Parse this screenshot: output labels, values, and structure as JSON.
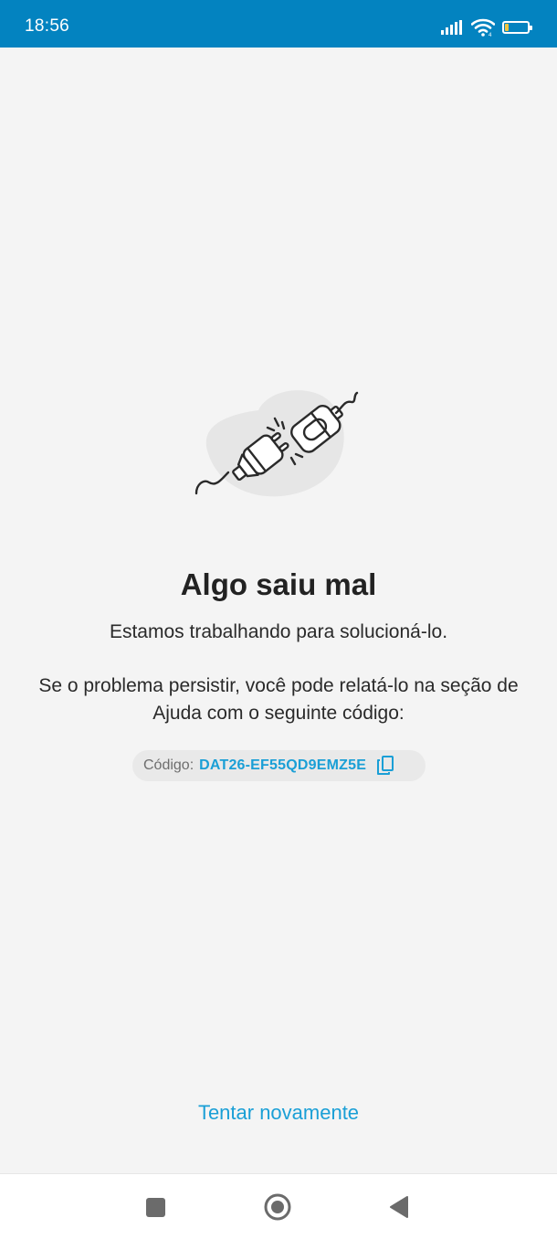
{
  "status_bar": {
    "time": "18:56",
    "battery_level": 15,
    "battery_text": "15",
    "icons": [
      "signal-icon",
      "wifi-icon",
      "battery-icon"
    ]
  },
  "error": {
    "title": "Algo saiu mal",
    "subtitle": "Estamos trabalhando para solucioná-lo.",
    "description": "Se o problema persistir, você pode relatá-lo na seção de Ajuda com o seguinte código:",
    "code_label": "Código:",
    "code_value": "DAT26-EF55QD9EMZ5E",
    "illustration": "unplugged-cable-icon"
  },
  "actions": {
    "retry_label": "Tentar novamente"
  },
  "nav_bar": {
    "buttons": [
      "recents-button",
      "home-button",
      "back-button"
    ]
  },
  "colors": {
    "status_bar_bg": "#0383c0",
    "page_bg": "#f4f4f4",
    "accent": "#1a9fd6",
    "title_text": "#222222",
    "code_chip_bg": "#e9e9e9",
    "battery_fill": "#f4c43c"
  }
}
